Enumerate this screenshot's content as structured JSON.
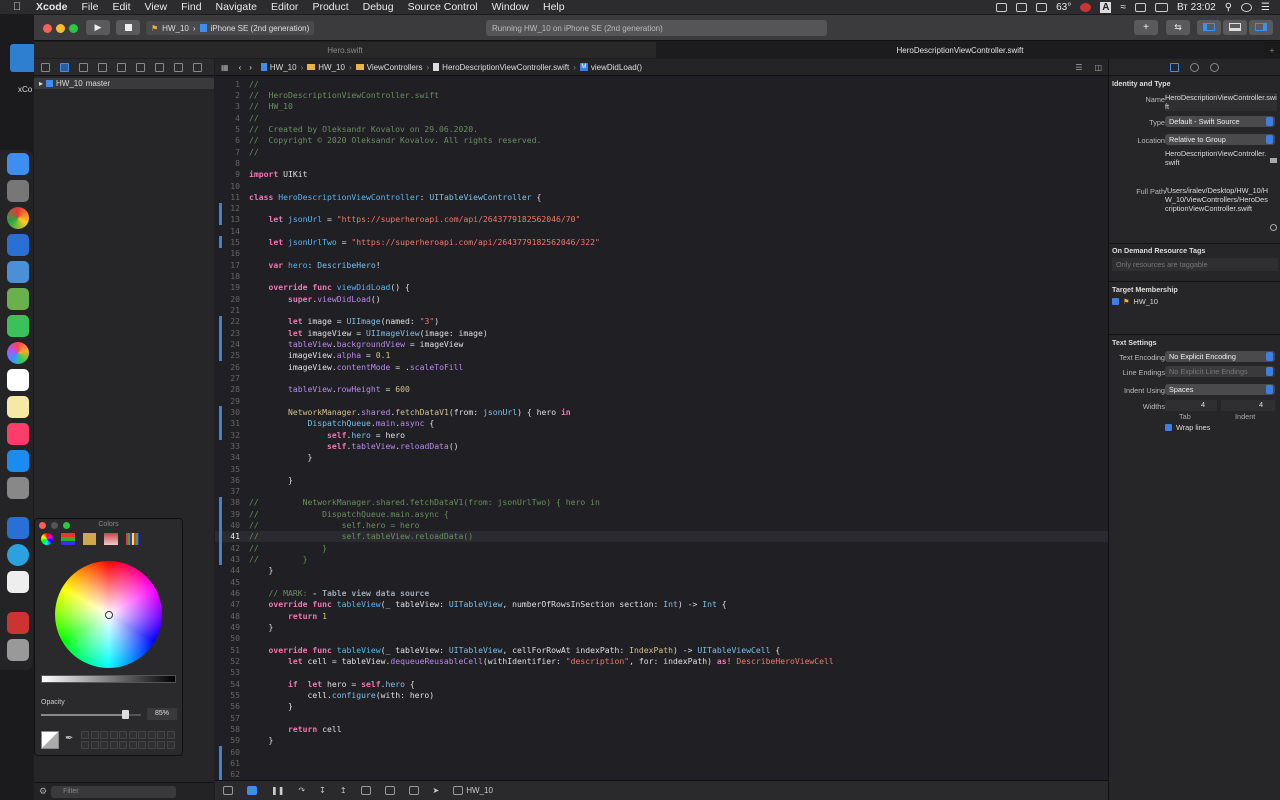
{
  "menubar": {
    "app": "Xcode",
    "items": [
      "File",
      "Edit",
      "View",
      "Find",
      "Navigate",
      "Editor",
      "Product",
      "Debug",
      "Source Control",
      "Window",
      "Help"
    ],
    "temperature": "63°",
    "input": "A",
    "clock": "Вт 23:02"
  },
  "desktop": {
    "folder_label": "xCo"
  },
  "toolbar": {
    "scheme": "HW_10",
    "device": "iPhone SE (2nd generation)",
    "status": "Running HW_10 on iPhone SE (2nd generation)"
  },
  "tabs": [
    "Hero.swift",
    "HeroDescriptionViewController.swift"
  ],
  "navigator": {
    "project": "HW_10",
    "branch": "master",
    "filter_placeholder": "Filter"
  },
  "jumpbar": [
    "HW_10",
    "HW_10",
    "ViewControllers",
    "HeroDescriptionViewController.swift",
    "viewDidLoad()"
  ],
  "editor": {
    "current_line": 41
  },
  "debugbar": {
    "target": "HW_10"
  },
  "inspector": {
    "identity_title": "Identity and Type",
    "name_label": "Name",
    "name_value": "HeroDescriptionViewController.swift",
    "type_label": "Type",
    "type_value": "Default - Swift Source",
    "location_label": "Location",
    "location_value": "Relative to Group",
    "location_file": "HeroDescriptionViewController.swift",
    "fullpath_label": "Full Path",
    "fullpath_value": "/Users/iralev/Desktop/HW_10/HW_10/ViewControllers/HeroDescriptionViewController.swift",
    "odr_title": "On Demand Resource Tags",
    "odr_placeholder": "Only resources are taggable",
    "membership_title": "Target Membership",
    "membership_target": "HW_10",
    "text_settings_title": "Text Settings",
    "encoding_label": "Text Encoding",
    "encoding_value": "No Explicit Encoding",
    "endings_label": "Line Endings",
    "endings_value": "No Explicit Line Endings",
    "indent_label": "Indent Using",
    "indent_value": "Spaces",
    "widths_label": "Widths",
    "tab_width": "4",
    "indent_width": "4",
    "tab_caption": "Tab",
    "indent_caption": "Indent",
    "wrap_label": "Wrap lines"
  },
  "colors_panel": {
    "title": "Colors",
    "opacity_label": "Opacity",
    "opacity_value": "85%",
    "opacity": 0.85
  },
  "code": [
    {
      "n": 1,
      "h": "<span class=\"cmt\">//</span>"
    },
    {
      "n": 2,
      "h": "<span class=\"cmt\">//  HeroDescriptionViewController.swift</span>"
    },
    {
      "n": 3,
      "h": "<span class=\"cmt\">//  HW_10</span>"
    },
    {
      "n": 4,
      "h": "<span class=\"cmt\">//</span>"
    },
    {
      "n": 5,
      "h": "<span class=\"cmt\">//  Created by Oleksandr Kovalov on 29.06.2020.</span>"
    },
    {
      "n": 6,
      "h": "<span class=\"cmt\">//  Copyright © 2020 Oleksandr Kovalov. All rights reserved.</span>"
    },
    {
      "n": 7,
      "h": "<span class=\"cmt\">//</span>"
    },
    {
      "n": 8,
      "h": ""
    },
    {
      "n": 9,
      "h": "<span class=\"kw\">import</span> UIKit"
    },
    {
      "n": 10,
      "h": ""
    },
    {
      "n": 11,
      "h": "<span class=\"kw\">class</span> <span class=\"typd\">HeroDescriptionViewController</span>: <span class=\"typ\">UITableViewController</span> {"
    },
    {
      "n": 12,
      "h": ""
    },
    {
      "n": 13,
      "h": "    <span class=\"kw\">let</span> <span class=\"typd\">jsonUrl</span> = <span class=\"str\">\"https://superheroapi.com/api/2643779182562046/70\"</span>"
    },
    {
      "n": 14,
      "h": ""
    },
    {
      "n": 15,
      "h": "    <span class=\"kw\">let</span> <span class=\"typd\">jsonUrlTwo</span> = <span class=\"str\">\"https://superheroapi.com/api/2643779182562046/322\"</span>"
    },
    {
      "n": 16,
      "h": ""
    },
    {
      "n": 17,
      "h": "    <span class=\"kw\">var</span> <span class=\"typd\">hero</span>: <span class=\"typ\">DescribeHero</span>!"
    },
    {
      "n": 18,
      "h": ""
    },
    {
      "n": 19,
      "h": "    <span class=\"kw\">override func</span> <span class=\"typd\">viewDidLoad</span>() {"
    },
    {
      "n": 20,
      "h": "        <span class=\"kw\">super</span>.<span class=\"fn\">viewDidLoad</span>()"
    },
    {
      "n": 21,
      "h": ""
    },
    {
      "n": 22,
      "h": "        <span class=\"kw\">let</span> image = <span class=\"typ\">UIImage</span>(named: <span class=\"str\">\"3\"</span>)"
    },
    {
      "n": 23,
      "h": "        <span class=\"kw\">let</span> imageView = <span class=\"typ\">UIImageView</span>(image: image)"
    },
    {
      "n": 24,
      "h": "        <span class=\"prop\">tableView</span>.<span class=\"prop\">backgroundView</span> = imageView"
    },
    {
      "n": 25,
      "h": "        imageView.<span class=\"prop\">alpha</span> = <span class=\"num\">0.1</span>"
    },
    {
      "n": 26,
      "h": "        imageView.<span class=\"prop\">contentMode</span> = .<span class=\"prop\">scaleToFill</span>"
    },
    {
      "n": 27,
      "h": ""
    },
    {
      "n": 28,
      "h": "        <span class=\"prop\">tableView</span>.<span class=\"prop\">rowHeight</span> = <span class=\"num\">600</span>"
    },
    {
      "n": 29,
      "h": ""
    },
    {
      "n": 30,
      "h": "        <span class=\"num\">NetworkManager</span>.<span class=\"prop\">shared</span>.<span class=\"num\">fetchDataV1</span>(from: <span class=\"typ\">jsonUrl</span>) { hero <span class=\"kw\">in</span>"
    },
    {
      "n": 31,
      "h": "            <span class=\"typ\">DispatchQueue</span>.<span class=\"prop\">main</span>.<span class=\"fn\">async</span> {"
    },
    {
      "n": 32,
      "h": "                <span class=\"kw\">self</span>.<span class=\"typ\">hero</span> = hero"
    },
    {
      "n": 33,
      "h": "                <span class=\"kw\">self</span>.<span class=\"prop\">tableView</span>.<span class=\"fn\">reloadData</span>()"
    },
    {
      "n": 34,
      "h": "            }"
    },
    {
      "n": 35,
      "h": ""
    },
    {
      "n": 36,
      "h": "        }"
    },
    {
      "n": 37,
      "h": ""
    },
    {
      "n": 38,
      "h": "<span class=\"cmt\">//         NetworkManager.shared.fetchDataV1(from: jsonUrlTwo) { hero in</span>"
    },
    {
      "n": 39,
      "h": "<span class=\"cmt\">//             DispatchQueue.main.async {</span>"
    },
    {
      "n": 40,
      "h": "<span class=\"cmt\">//                 self.hero = hero</span>"
    },
    {
      "n": 41,
      "h": "<span class=\"cmt\">//                 self.tableView.reloadData()</span>"
    },
    {
      "n": 42,
      "h": "<span class=\"cmt\">//             }</span>"
    },
    {
      "n": 43,
      "h": "<span class=\"cmt\">//         }</span>"
    },
    {
      "n": 44,
      "h": "    }"
    },
    {
      "n": 45,
      "h": ""
    },
    {
      "n": 46,
      "h": "    <span class=\"cmt\">// MARK: </span><span class=\"mark\">- Table view data source</span>"
    },
    {
      "n": 47,
      "h": "    <span class=\"kw\">override func</span> <span class=\"typd\">tableView</span>(_ tableView: <span class=\"typ\">UITableView</span>, numberOfRowsInSection section: <span class=\"typ\">Int</span>) -> <span class=\"typ\">Int</span> {"
    },
    {
      "n": 48,
      "h": "        <span class=\"kw\">return</span> <span class=\"num\">1</span>"
    },
    {
      "n": 49,
      "h": "    }"
    },
    {
      "n": 50,
      "h": ""
    },
    {
      "n": 51,
      "h": "    <span class=\"kw\">override func</span> <span class=\"typd\">tableView</span>(_ tableView: <span class=\"typ\">UITableView</span>, cellForRowAt indexPath: <span class=\"num\">IndexPath</span>) -> <span class=\"typ\">UITableViewCell</span> {"
    },
    {
      "n": 52,
      "h": "        <span class=\"kw\">let</span> cell = tableView.<span class=\"fn\">dequeueReusableCell</span>(withIdentifier: <span class=\"str\">\"description\"</span>, for: indexPath) <span class=\"kw\">as!</span> <span class=\"str\">DescribeHeroViewCell</span>"
    },
    {
      "n": 53,
      "h": ""
    },
    {
      "n": 54,
      "h": "        <span class=\"kw\">if</span>  <span class=\"kw\">let</span> hero = <span class=\"kw\">self</span>.<span class=\"typ\">hero</span> {"
    },
    {
      "n": 55,
      "h": "            cell.<span class=\"typ\">configure</span>(with: hero)"
    },
    {
      "n": 56,
      "h": "        }"
    },
    {
      "n": 57,
      "h": ""
    },
    {
      "n": 58,
      "h": "        <span class=\"kw\">return</span> cell"
    },
    {
      "n": 59,
      "h": "    }"
    },
    {
      "n": 60,
      "h": ""
    },
    {
      "n": 61,
      "h": ""
    },
    {
      "n": 62,
      "h": ""
    }
  ]
}
